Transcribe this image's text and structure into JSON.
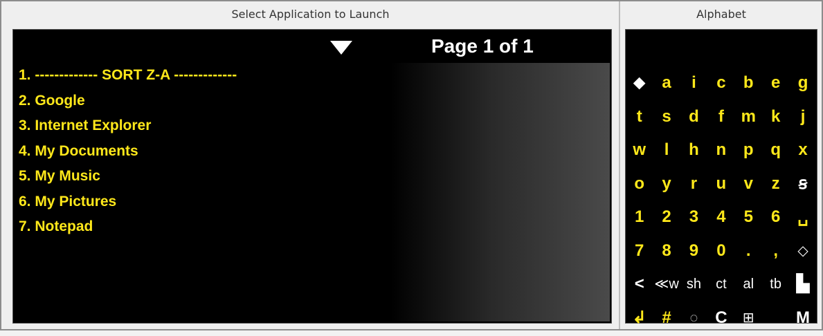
{
  "left_panel": {
    "title": "Select Application to Launch",
    "page_indicator": "Page 1 of 1",
    "items": [
      "1. ------------- SORT Z-A -------------",
      "2. Google",
      "3. Internet Explorer",
      "4. My Documents",
      "5. My Music",
      "6. My Pictures",
      "7. Notepad"
    ]
  },
  "right_panel": {
    "title": "Alphabet",
    "rows": [
      [
        "⬥",
        "a",
        "i",
        "c",
        "b",
        "e",
        "g"
      ],
      [
        "t",
        "s",
        "d",
        "f",
        "m",
        "k",
        "j"
      ],
      [
        "w",
        "l",
        "h",
        "n",
        "p",
        "q",
        "x"
      ],
      [
        "o",
        "y",
        "r",
        "u",
        "v",
        "z",
        "ꞩ"
      ],
      [
        "1",
        "2",
        "3",
        "4",
        "5",
        "6",
        "␣"
      ],
      [
        "7",
        "8",
        "9",
        "0",
        ".",
        ",",
        "◇"
      ],
      [
        "<",
        "≪w",
        "sh",
        "ct",
        "al",
        "tb",
        "▙"
      ],
      [
        "↲",
        "#",
        "◌",
        "C",
        "⊞",
        "",
        "M"
      ]
    ]
  },
  "colors": {
    "accent": "#ffe81a",
    "panel_bg": "#000000",
    "frame_bg": "#efefef"
  }
}
